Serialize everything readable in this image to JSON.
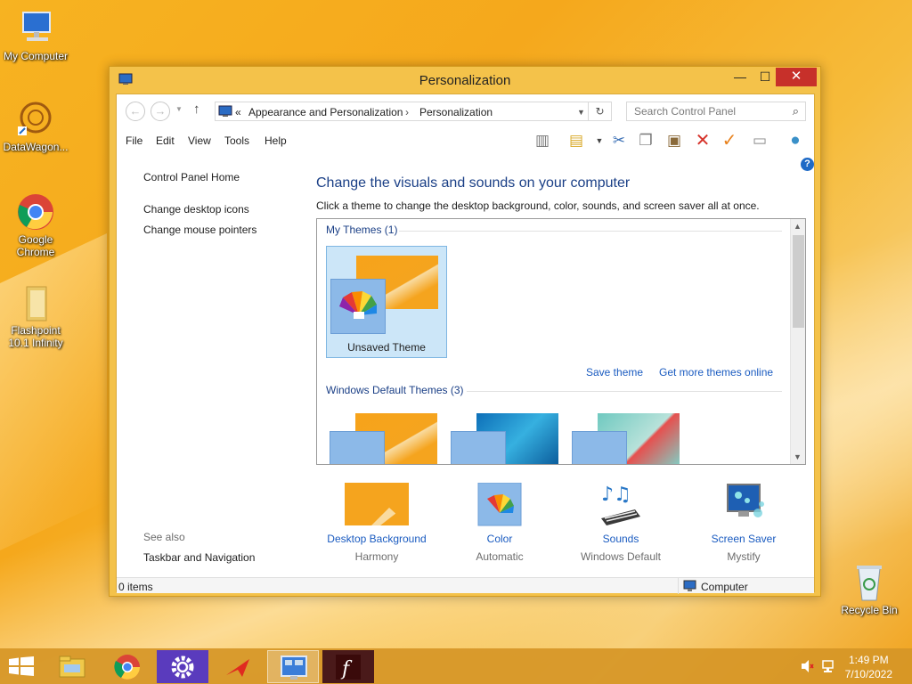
{
  "desktop": {
    "icons": [
      {
        "label": "My Computer"
      },
      {
        "label": "DataWagon..."
      },
      {
        "label": "Google Chrome"
      },
      {
        "label": "Flashpoint 10.1 Infinity"
      },
      {
        "label": "Recycle Bin"
      }
    ]
  },
  "window": {
    "title": "Personalization",
    "controls": {
      "minimize": "—",
      "maximize": "☐",
      "close": "✕"
    }
  },
  "address": {
    "chevrons": "«",
    "crumbs": [
      "Appearance and Personalization",
      "Personalization"
    ],
    "separator": "›",
    "search_placeholder": "Search Control Panel"
  },
  "menu": [
    "File",
    "Edit",
    "View",
    "Tools",
    "Help"
  ],
  "left_pane": {
    "home": "Control Panel Home",
    "links": [
      "Change desktop icons",
      "Change mouse pointers"
    ],
    "see_also_label": "See also",
    "see_also_links": [
      "Taskbar and Navigation"
    ]
  },
  "main": {
    "title": "Change the visuals and sounds on your computer",
    "description": "Click a theme to change the desktop background, color, sounds, and screen saver all at once.",
    "my_themes_header": "My Themes (1)",
    "my_theme_label": "Unsaved Theme",
    "save_theme": "Save theme",
    "get_more": "Get more themes online",
    "default_themes_header": "Windows Default Themes (3)"
  },
  "bottom": [
    {
      "link": "Desktop Background",
      "value": "Harmony"
    },
    {
      "link": "Color",
      "value": "Automatic"
    },
    {
      "link": "Sounds",
      "value": "Windows Default"
    },
    {
      "link": "Screen Saver",
      "value": "Mystify"
    }
  ],
  "status": {
    "items": "0 items",
    "location": "Computer"
  },
  "clock": {
    "time": "1:49 PM",
    "date": "7/10/2022"
  },
  "colors": {
    "accent": "#1a5bc0",
    "title_blue": "#1a3f86",
    "frame": "#f4c24a",
    "close": "#c7302a"
  }
}
